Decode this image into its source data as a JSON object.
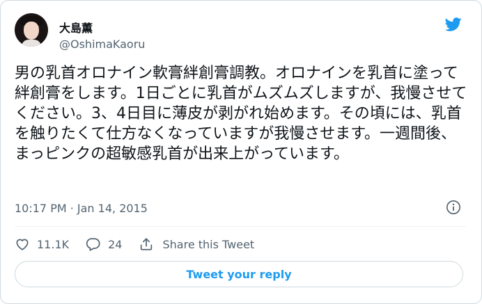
{
  "author": {
    "display_name": "大島薫",
    "handle": "@OshimaKaoru"
  },
  "tweet": {
    "text": "男の乳首オロナイン軟膏絆創膏調教。オロナインを乳首に塗って絆創膏をします。1日ごとに乳首がムズムズしますが、我慢させてください。3、4日目に薄皮が剥がれ始めます。その頃には、乳首を触りたくて仕方なくなっていますが我慢させます。一週間後、まっピンクの超敏感乳首が出来上がっています。",
    "timestamp": "10:17 PM · Jan 14, 2015"
  },
  "actions": {
    "like_count": "11.1K",
    "reply_count": "24",
    "share_label": "Share this Tweet"
  },
  "reply_button": {
    "label": "Tweet your reply"
  },
  "icons": {
    "brand": "twitter-bird-icon",
    "info": "info-icon",
    "like": "heart-icon",
    "reply": "speech-bubble-icon",
    "share": "share-upload-icon"
  },
  "colors": {
    "accent": "#1d9bf0",
    "text": "#0f1419",
    "secondary": "#536471",
    "border": "#cfd9de"
  }
}
